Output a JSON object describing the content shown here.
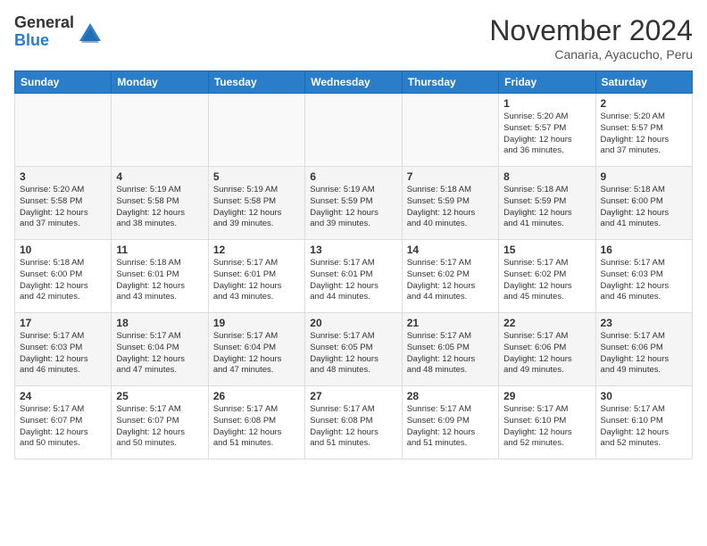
{
  "header": {
    "logo_line1": "General",
    "logo_line2": "Blue",
    "month": "November 2024",
    "location": "Canaria, Ayacucho, Peru"
  },
  "days_of_week": [
    "Sunday",
    "Monday",
    "Tuesday",
    "Wednesday",
    "Thursday",
    "Friday",
    "Saturday"
  ],
  "weeks": [
    [
      {
        "day": "",
        "info": ""
      },
      {
        "day": "",
        "info": ""
      },
      {
        "day": "",
        "info": ""
      },
      {
        "day": "",
        "info": ""
      },
      {
        "day": "",
        "info": ""
      },
      {
        "day": "1",
        "info": "Sunrise: 5:20 AM\nSunset: 5:57 PM\nDaylight: 12 hours\nand 36 minutes."
      },
      {
        "day": "2",
        "info": "Sunrise: 5:20 AM\nSunset: 5:57 PM\nDaylight: 12 hours\nand 37 minutes."
      }
    ],
    [
      {
        "day": "3",
        "info": "Sunrise: 5:20 AM\nSunset: 5:58 PM\nDaylight: 12 hours\nand 37 minutes."
      },
      {
        "day": "4",
        "info": "Sunrise: 5:19 AM\nSunset: 5:58 PM\nDaylight: 12 hours\nand 38 minutes."
      },
      {
        "day": "5",
        "info": "Sunrise: 5:19 AM\nSunset: 5:58 PM\nDaylight: 12 hours\nand 39 minutes."
      },
      {
        "day": "6",
        "info": "Sunrise: 5:19 AM\nSunset: 5:59 PM\nDaylight: 12 hours\nand 39 minutes."
      },
      {
        "day": "7",
        "info": "Sunrise: 5:18 AM\nSunset: 5:59 PM\nDaylight: 12 hours\nand 40 minutes."
      },
      {
        "day": "8",
        "info": "Sunrise: 5:18 AM\nSunset: 5:59 PM\nDaylight: 12 hours\nand 41 minutes."
      },
      {
        "day": "9",
        "info": "Sunrise: 5:18 AM\nSunset: 6:00 PM\nDaylight: 12 hours\nand 41 minutes."
      }
    ],
    [
      {
        "day": "10",
        "info": "Sunrise: 5:18 AM\nSunset: 6:00 PM\nDaylight: 12 hours\nand 42 minutes."
      },
      {
        "day": "11",
        "info": "Sunrise: 5:18 AM\nSunset: 6:01 PM\nDaylight: 12 hours\nand 43 minutes."
      },
      {
        "day": "12",
        "info": "Sunrise: 5:17 AM\nSunset: 6:01 PM\nDaylight: 12 hours\nand 43 minutes."
      },
      {
        "day": "13",
        "info": "Sunrise: 5:17 AM\nSunset: 6:01 PM\nDaylight: 12 hours\nand 44 minutes."
      },
      {
        "day": "14",
        "info": "Sunrise: 5:17 AM\nSunset: 6:02 PM\nDaylight: 12 hours\nand 44 minutes."
      },
      {
        "day": "15",
        "info": "Sunrise: 5:17 AM\nSunset: 6:02 PM\nDaylight: 12 hours\nand 45 minutes."
      },
      {
        "day": "16",
        "info": "Sunrise: 5:17 AM\nSunset: 6:03 PM\nDaylight: 12 hours\nand 46 minutes."
      }
    ],
    [
      {
        "day": "17",
        "info": "Sunrise: 5:17 AM\nSunset: 6:03 PM\nDaylight: 12 hours\nand 46 minutes."
      },
      {
        "day": "18",
        "info": "Sunrise: 5:17 AM\nSunset: 6:04 PM\nDaylight: 12 hours\nand 47 minutes."
      },
      {
        "day": "19",
        "info": "Sunrise: 5:17 AM\nSunset: 6:04 PM\nDaylight: 12 hours\nand 47 minutes."
      },
      {
        "day": "20",
        "info": "Sunrise: 5:17 AM\nSunset: 6:05 PM\nDaylight: 12 hours\nand 48 minutes."
      },
      {
        "day": "21",
        "info": "Sunrise: 5:17 AM\nSunset: 6:05 PM\nDaylight: 12 hours\nand 48 minutes."
      },
      {
        "day": "22",
        "info": "Sunrise: 5:17 AM\nSunset: 6:06 PM\nDaylight: 12 hours\nand 49 minutes."
      },
      {
        "day": "23",
        "info": "Sunrise: 5:17 AM\nSunset: 6:06 PM\nDaylight: 12 hours\nand 49 minutes."
      }
    ],
    [
      {
        "day": "24",
        "info": "Sunrise: 5:17 AM\nSunset: 6:07 PM\nDaylight: 12 hours\nand 50 minutes."
      },
      {
        "day": "25",
        "info": "Sunrise: 5:17 AM\nSunset: 6:07 PM\nDaylight: 12 hours\nand 50 minutes."
      },
      {
        "day": "26",
        "info": "Sunrise: 5:17 AM\nSunset: 6:08 PM\nDaylight: 12 hours\nand 51 minutes."
      },
      {
        "day": "27",
        "info": "Sunrise: 5:17 AM\nSunset: 6:08 PM\nDaylight: 12 hours\nand 51 minutes."
      },
      {
        "day": "28",
        "info": "Sunrise: 5:17 AM\nSunset: 6:09 PM\nDaylight: 12 hours\nand 51 minutes."
      },
      {
        "day": "29",
        "info": "Sunrise: 5:17 AM\nSunset: 6:10 PM\nDaylight: 12 hours\nand 52 minutes."
      },
      {
        "day": "30",
        "info": "Sunrise: 5:17 AM\nSunset: 6:10 PM\nDaylight: 12 hours\nand 52 minutes."
      }
    ]
  ]
}
